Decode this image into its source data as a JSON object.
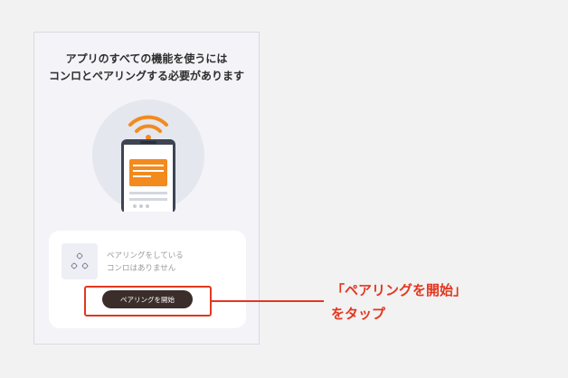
{
  "screen": {
    "headline_line1": "アプリのすべての機能を使うには",
    "headline_line2": "コンロとペアリングする必要があります"
  },
  "pairing_card": {
    "status_line1": "ペアリングをしている",
    "status_line2": "コンロはありません",
    "button_label": "ペアリングを開始"
  },
  "annotation": {
    "line1": "「ペアリングを開始」",
    "line2": "をタップ"
  },
  "colors": {
    "accent": "#e2371f",
    "wifi": "#f28a1e",
    "button": "#3a2d2a"
  },
  "icons": {
    "illustration": "phone-with-wifi-icon",
    "stove": "stove-burners-icon"
  }
}
